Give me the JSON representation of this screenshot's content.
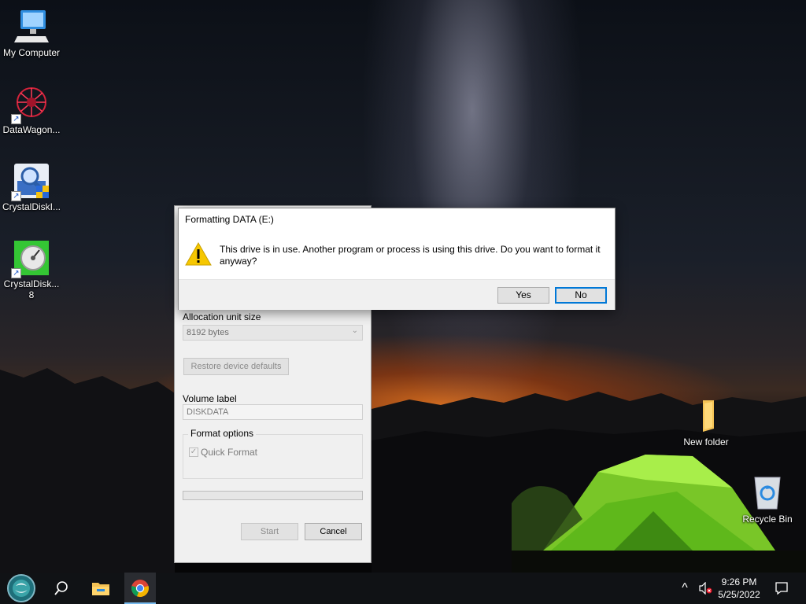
{
  "desktop": {
    "icons": [
      {
        "label": "My Computer"
      },
      {
        "label": "DataWagon..."
      },
      {
        "label": "CrystalDiskI..."
      },
      {
        "label": "CrystalDisk...",
        "label2": "8"
      },
      {
        "label": "New folder"
      },
      {
        "label": "Recycle Bin"
      }
    ]
  },
  "format_dialog": {
    "allocation_label": "Allocation unit size",
    "allocation_value": "8192 bytes",
    "restore_button": "Restore device defaults",
    "volume_label_label": "Volume label",
    "volume_label_value": "DISKDATA",
    "format_options_title": "Format options",
    "quick_format_label": "Quick Format",
    "quick_format_checked": true,
    "start_button": "Start",
    "cancel_button": "Cancel"
  },
  "message_box": {
    "title": "Formatting DATA (E:)",
    "message": "This drive is in use. Another program or process is using this drive. Do you want to format it anyway?",
    "icon": "warning-icon",
    "yes_button": "Yes",
    "no_button": "No"
  },
  "taskbar": {
    "items": [
      "start-button",
      "search-icon",
      "file-explorer-icon",
      "chrome-icon"
    ],
    "tray_chevron": "^",
    "clock_time": "9:26 PM",
    "clock_date": "5/25/2022"
  },
  "colors": {
    "accent": "#0078d7",
    "taskbar": "#101215",
    "tent": "#7fd12a"
  }
}
